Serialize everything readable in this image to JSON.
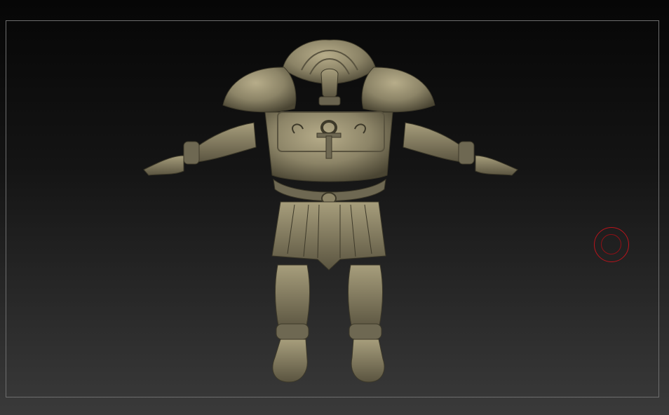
{
  "viewport": {
    "background_top": "#060606",
    "background_bottom": "#3a3a3a",
    "frame_color": "#6e6e6e"
  },
  "model": {
    "material_color": "#8c8467",
    "highlight_color": "#b7ad8a",
    "shadow_color": "#3d3929"
  },
  "brush_cursor": {
    "color": "#b8141c"
  }
}
